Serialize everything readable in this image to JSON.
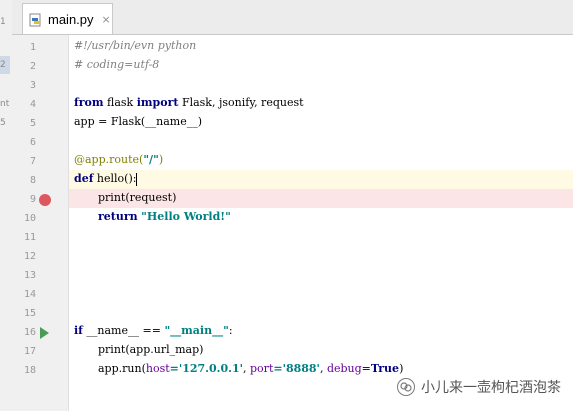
{
  "tab": {
    "filename": "main.py",
    "close_glyph": "×",
    "icon": "python-file-icon"
  },
  "left_strip": {
    "ticks": [
      "1",
      "2",
      "nt",
      "5"
    ]
  },
  "gutter": {
    "line_numbers": [
      "1",
      "2",
      "3",
      "4",
      "5",
      "6",
      "7",
      "8",
      "9",
      "10",
      "11",
      "12",
      "13",
      "14",
      "15",
      "16",
      "17",
      "18"
    ],
    "breakpoint_line": 9,
    "run_marker_line": 16,
    "breakpoint_color": "#db5860",
    "run_marker_color": "#499c54"
  },
  "code": {
    "line1": "#!/usr/bin/evn python",
    "line2": "# coding=utf-8",
    "line4": {
      "kw1": "from",
      "mod": " flask ",
      "kw2": "import",
      "rest": " Flask, jsonify, request"
    },
    "line5": "app = Flask(__name__)",
    "line7": {
      "dec": "@app.route(",
      "str": "\"/\"",
      "tail": ")"
    },
    "line8": {
      "kw": "def",
      "rest": " hello():"
    },
    "line9": "print(request)",
    "line10": {
      "kw": "return",
      "str": "\"Hello World!\""
    },
    "line16": {
      "kw": "if",
      "mid": " __name__ == ",
      "str": "\"__main__\"",
      "tail": ":"
    },
    "line17": "print(app.url_map)",
    "line18": {
      "head": "app.run(",
      "k1": "host",
      "v1": "='127.0.0.1'",
      "sep1": ", ",
      "k2": "port",
      "v2": "='8888'",
      "sep2": ", ",
      "k3": "debug",
      "v3": "=",
      "kwtrue": "True",
      "tail": ")"
    }
  },
  "watermark": {
    "text": "小儿来一壶枸杞酒泡茶"
  },
  "colors": {
    "keyword": "#000080",
    "string": "#008080",
    "comment": "#808080",
    "decorator": "#808000",
    "kwarg": "#660099",
    "caret_line": "#fffae3",
    "breakpoint_line_bg": "#fbe5e6"
  }
}
